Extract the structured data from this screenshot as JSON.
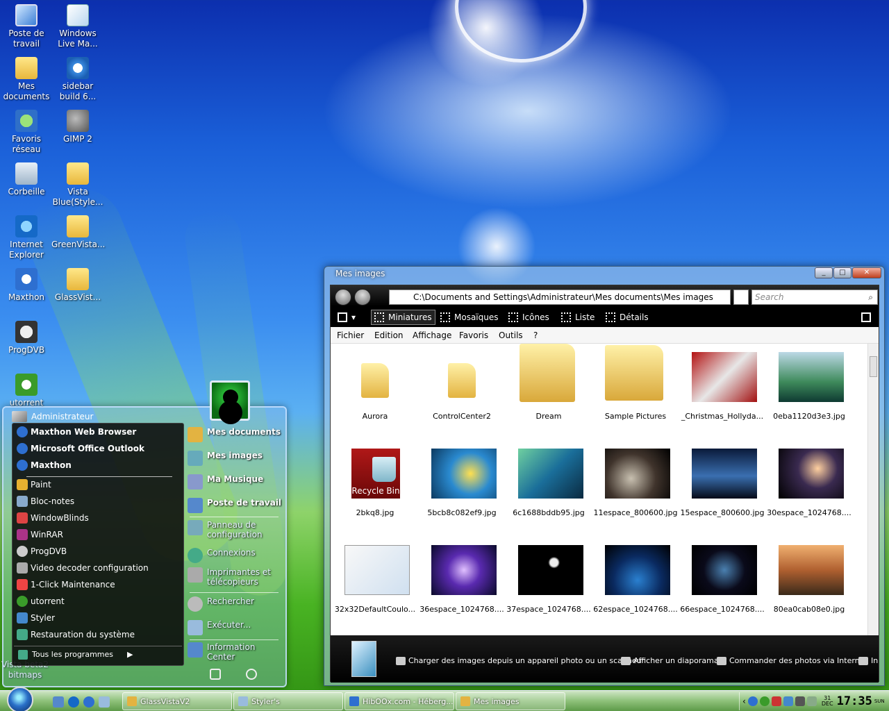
{
  "desktop": {
    "icons": [
      {
        "label": "Poste de travail",
        "icon": "computer-icon"
      },
      {
        "label": "Windows Live Ma...",
        "icon": "mail-icon"
      },
      {
        "label": "Mes documents",
        "icon": "documents-icon"
      },
      {
        "label": "sidebar build 6...",
        "icon": "gear-icon"
      },
      {
        "label": "Favoris réseau",
        "icon": "network-icon"
      },
      {
        "label": "GIMP 2",
        "icon": "gimp-icon"
      },
      {
        "label": "Corbeille",
        "icon": "recycle-bin-icon"
      },
      {
        "label": "Vista Blue(Style...",
        "icon": "folder-icon"
      },
      {
        "label": "Internet Explorer",
        "icon": "internet-explorer-icon"
      },
      {
        "label": "GreenVista...",
        "icon": "folder-icon"
      },
      {
        "label": "Maxthon",
        "icon": "maxthon-icon"
      },
      {
        "label": "GlassVist...",
        "icon": "folder-icon"
      },
      {
        "label": "ProgDVB",
        "icon": "satellite-icon"
      },
      {
        "label": "utorrent",
        "icon": "utorrent-icon"
      }
    ],
    "hidden_label": "Vista beta2 bitmaps"
  },
  "start_menu": {
    "user": "Administrateur",
    "pinned": [
      "Maxthon Web Browser",
      "Microsoft Office Outlook",
      "Maxthon"
    ],
    "recent": [
      "Paint",
      "Bloc-notes",
      "WindowBlinds",
      "WinRAR",
      "ProgDVB",
      "Video decoder configuration",
      "1-Click Maintenance",
      "utorrent",
      "Styler",
      "Restauration du système"
    ],
    "all_programs": "Tous les programmes",
    "right": [
      "Mes documents",
      "Mes images",
      "Ma Musique",
      "Poste de travail"
    ],
    "right_system": [
      "Panneau de configuration",
      "Connexions",
      "Imprimantes et télécopieurs"
    ],
    "right_tools": [
      "Rechercher",
      "Exécuter...",
      "Information Center"
    ]
  },
  "explorer": {
    "title": "Mes images",
    "address": "C:\\Documents and Settings\\Administrateur\\Mes documents\\Mes images",
    "search_placeholder": "Search",
    "views": [
      "Miniatures",
      "Mosaïques",
      "Icônes",
      "Liste",
      "Détails"
    ],
    "menu": [
      "Fichier",
      "Edition",
      "Affichage",
      "Favoris",
      "Outils",
      "?"
    ],
    "items": [
      "Aurora",
      "ControlCenter2",
      "Dream",
      "Sample Pictures",
      "_Christmas_Hollyda...",
      "0eba1120d3e3.jpg",
      "2bkq8.jpg",
      "5bcb8c082ef9.jpg",
      "6c1688bddb95.jpg",
      "11espace_800600.jpg",
      "15espace_800600.jpg",
      "30espace_1024768....",
      "32x32DefaultCoulo...",
      "36espace_1024768....",
      "37espace_1024768....",
      "62espace_1024768....",
      "66espace_1024768....",
      "80ea0cab08e0.jpg"
    ],
    "recycle_thumb_label": "Recycle Bin",
    "tasks": [
      "Charger des images depuis un appareil photo ou un scanneur",
      "Afficher un diaporama",
      "Commander des photos via Internet",
      "In"
    ]
  },
  "taskbar": {
    "tasks": [
      "GlassVistaV2",
      "Styler's",
      "HibOOx.com - Héberg...",
      "Mes images"
    ],
    "date_day": "31",
    "date_month": "DEC",
    "time": "17:35",
    "weekday": "SUN"
  },
  "colors": {
    "start_menu_bg": "#0a0a0a",
    "accent": "#2a6fc8"
  }
}
